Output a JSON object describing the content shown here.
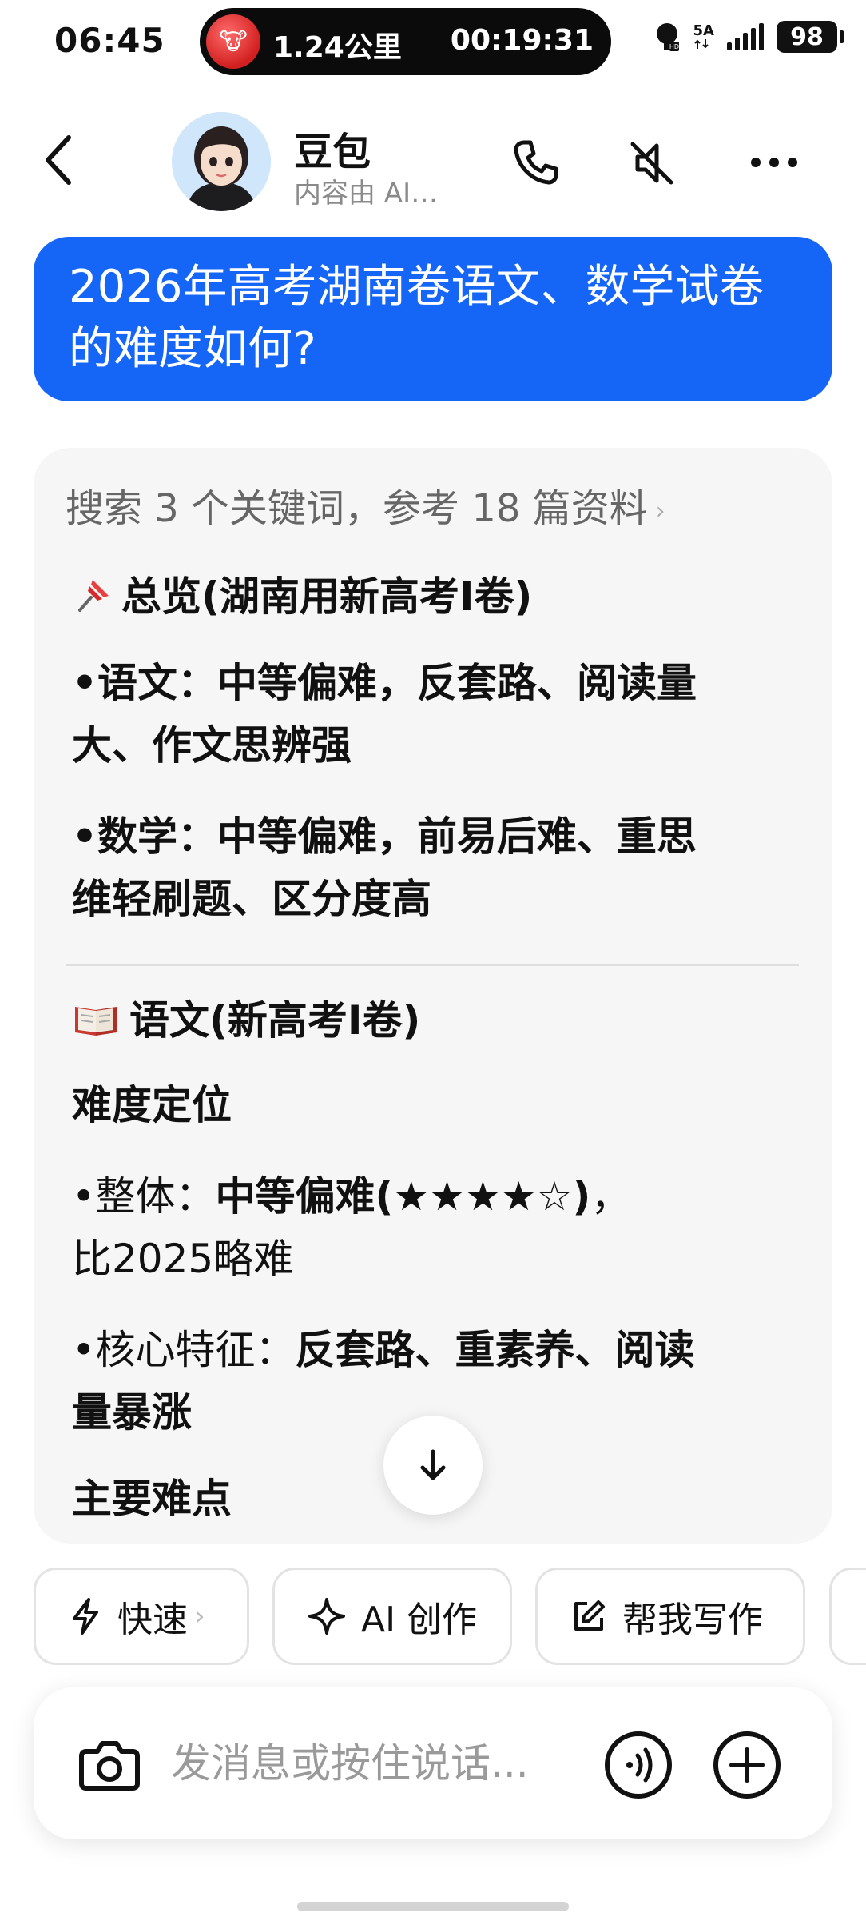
{
  "status_bar": {
    "time": "06:45",
    "island_distance": "1.24公里",
    "island_duration": "00:19:31",
    "network_label": "5A",
    "battery": "98"
  },
  "header": {
    "bot_name": "豆包",
    "bot_subtitle": "内容由 AI…"
  },
  "user_message": "2026年高考湖南卷语文、数学试卷的难度如何?",
  "answer": {
    "search_summary": "搜索 3 个关键词，参考 18 篇资料",
    "overview_title": "总览(湖南用新高考Ⅰ卷)",
    "overview_chinese": "•语文：中等偏难，反套路、阅读量大、作文思辨强",
    "overview_chinese_l1": "•语文：中等偏难，反套路、阅读量",
    "overview_chinese_l2": "大、作文思辨强",
    "overview_math_l1": "•数学：中等偏难，前易后难、重思",
    "overview_math_l2": "维轻刷题、区分度高",
    "section_chinese_title": "语文(新高考Ⅰ卷)",
    "difficulty_heading": "难度定位",
    "overall_label": "•整体：",
    "overall_value": "中等偏难(★★★★☆)",
    "overall_suffix": "，",
    "overall_l2": "比2025略难",
    "core_label": "•核心特征：",
    "core_value_l1": "反套路、重素养、阅读",
    "core_value_l2": "量暴涨",
    "main_difficulties_heading": "主要难点"
  },
  "chips": {
    "fast": "快速",
    "ai_create": "AI 创作",
    "help_write": "帮我写作"
  },
  "input": {
    "placeholder": "发消息或按住说话..."
  },
  "colors": {
    "user_bubble": "#1565f7",
    "card_bg": "#f6f6f6"
  },
  "icons": [
    "back-icon",
    "phone-icon",
    "mute-icon",
    "more-icon",
    "pin-icon",
    "book-icon",
    "arrow-down-icon",
    "lightning-icon",
    "sparkle-icon",
    "edit-icon",
    "camera-icon",
    "voice-icon",
    "plus-icon"
  ]
}
